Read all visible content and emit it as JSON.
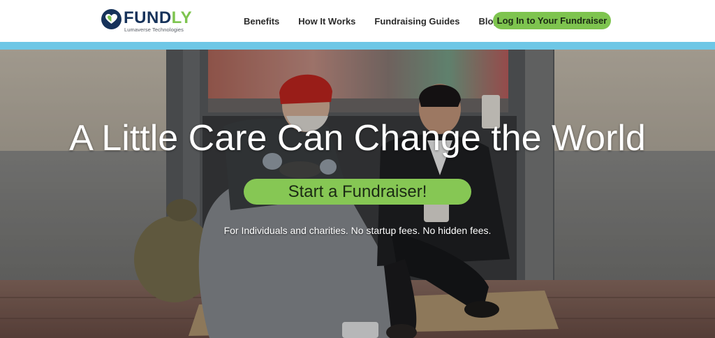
{
  "brand": {
    "name_main": "FUND",
    "name_accent": "LY",
    "tagline": "Lumaverse Technologies",
    "colors": {
      "navy": "#16325a",
      "green": "#7ec44f",
      "accent_bar": "#6ec7e6"
    }
  },
  "nav": {
    "items": [
      {
        "label": "Benefits"
      },
      {
        "label": "How It Works"
      },
      {
        "label": "Fundraising Guides"
      },
      {
        "label": "Blog"
      }
    ],
    "login_label": "Log In to Your Fundraiser"
  },
  "hero": {
    "title": "A Little Care Can Change the World",
    "cta_label": "Start a Fundraiser!",
    "subtitle": "For Individuals and charities. No startup fees. No hidden fees.",
    "image_description": "photo-two-men-sitting-on-sidewalk"
  },
  "icons": {
    "logo": "heart-badge-icon"
  }
}
